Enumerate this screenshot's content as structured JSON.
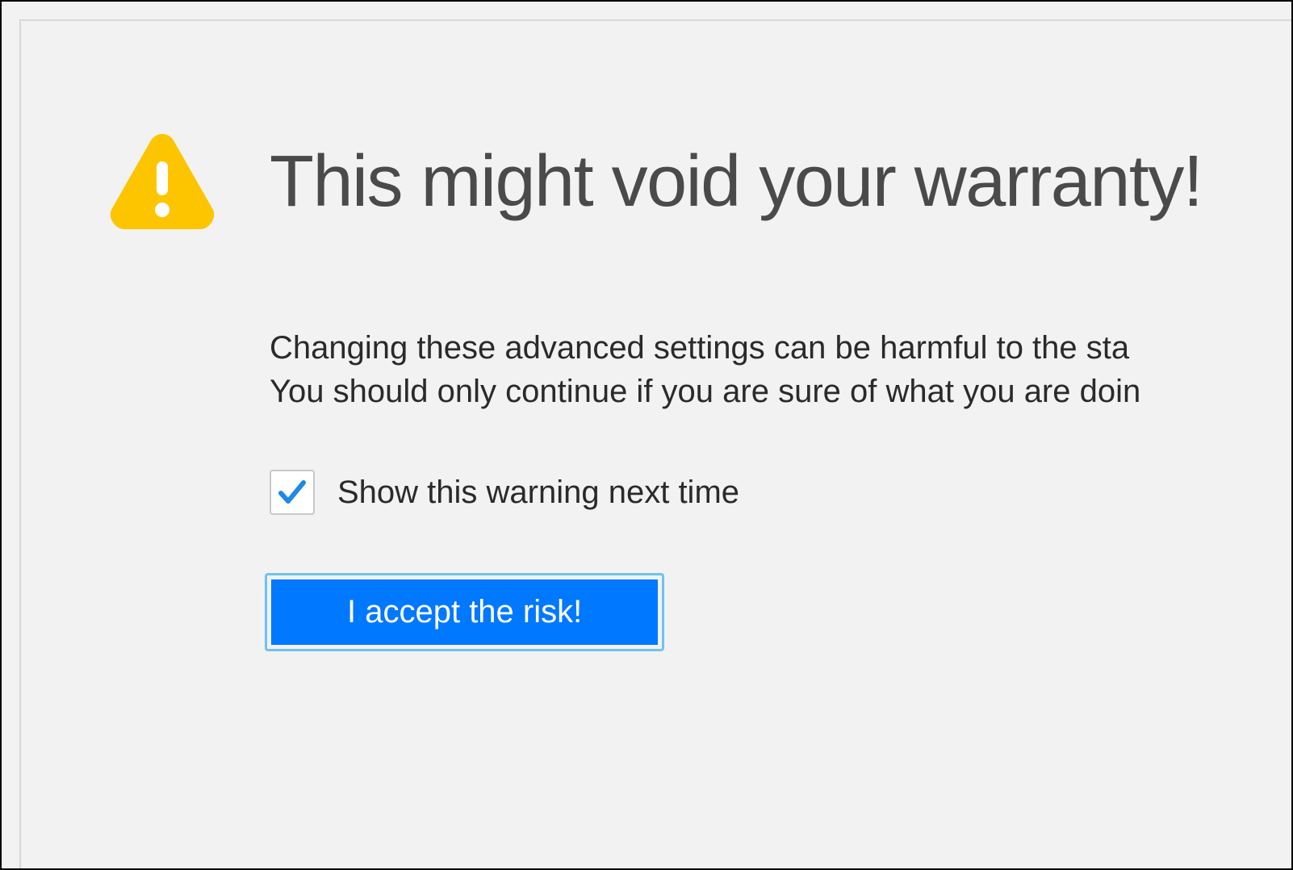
{
  "warning": {
    "title": "This might void your warranty!",
    "body_line1": "Changing these advanced settings can be harmful to the sta",
    "body_line2": "You should only continue if you are sure of what you are doin",
    "checkbox_label": "Show this warning next time",
    "checkbox_checked": true,
    "accept_button": "I accept the risk!"
  },
  "colors": {
    "warning_icon": "#fdc500",
    "accent_blue": "#0078ff",
    "check_blue": "#1f8ae6",
    "focus_ring": "#6fc2ee"
  }
}
